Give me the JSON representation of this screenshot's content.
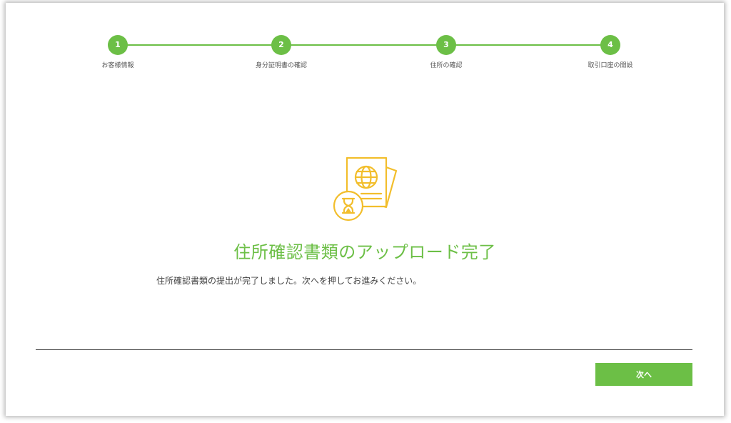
{
  "stepper": {
    "steps": [
      {
        "number": "1",
        "label": "お客様情報"
      },
      {
        "number": "2",
        "label": "身分証明書の確認"
      },
      {
        "number": "3",
        "label": "住所の確認"
      },
      {
        "number": "4",
        "label": "取引口座の開設"
      }
    ]
  },
  "illustration": {
    "icon": "passport-hourglass-icon",
    "color": "#f2be2c"
  },
  "main": {
    "title": "住所確認書類のアップロード完了",
    "message": "住所確認書類の提出が完了しました。次へを押してお進みください。"
  },
  "footer": {
    "next_label": "次へ"
  },
  "colors": {
    "accent": "#6cbf46",
    "icon": "#f2be2c"
  }
}
